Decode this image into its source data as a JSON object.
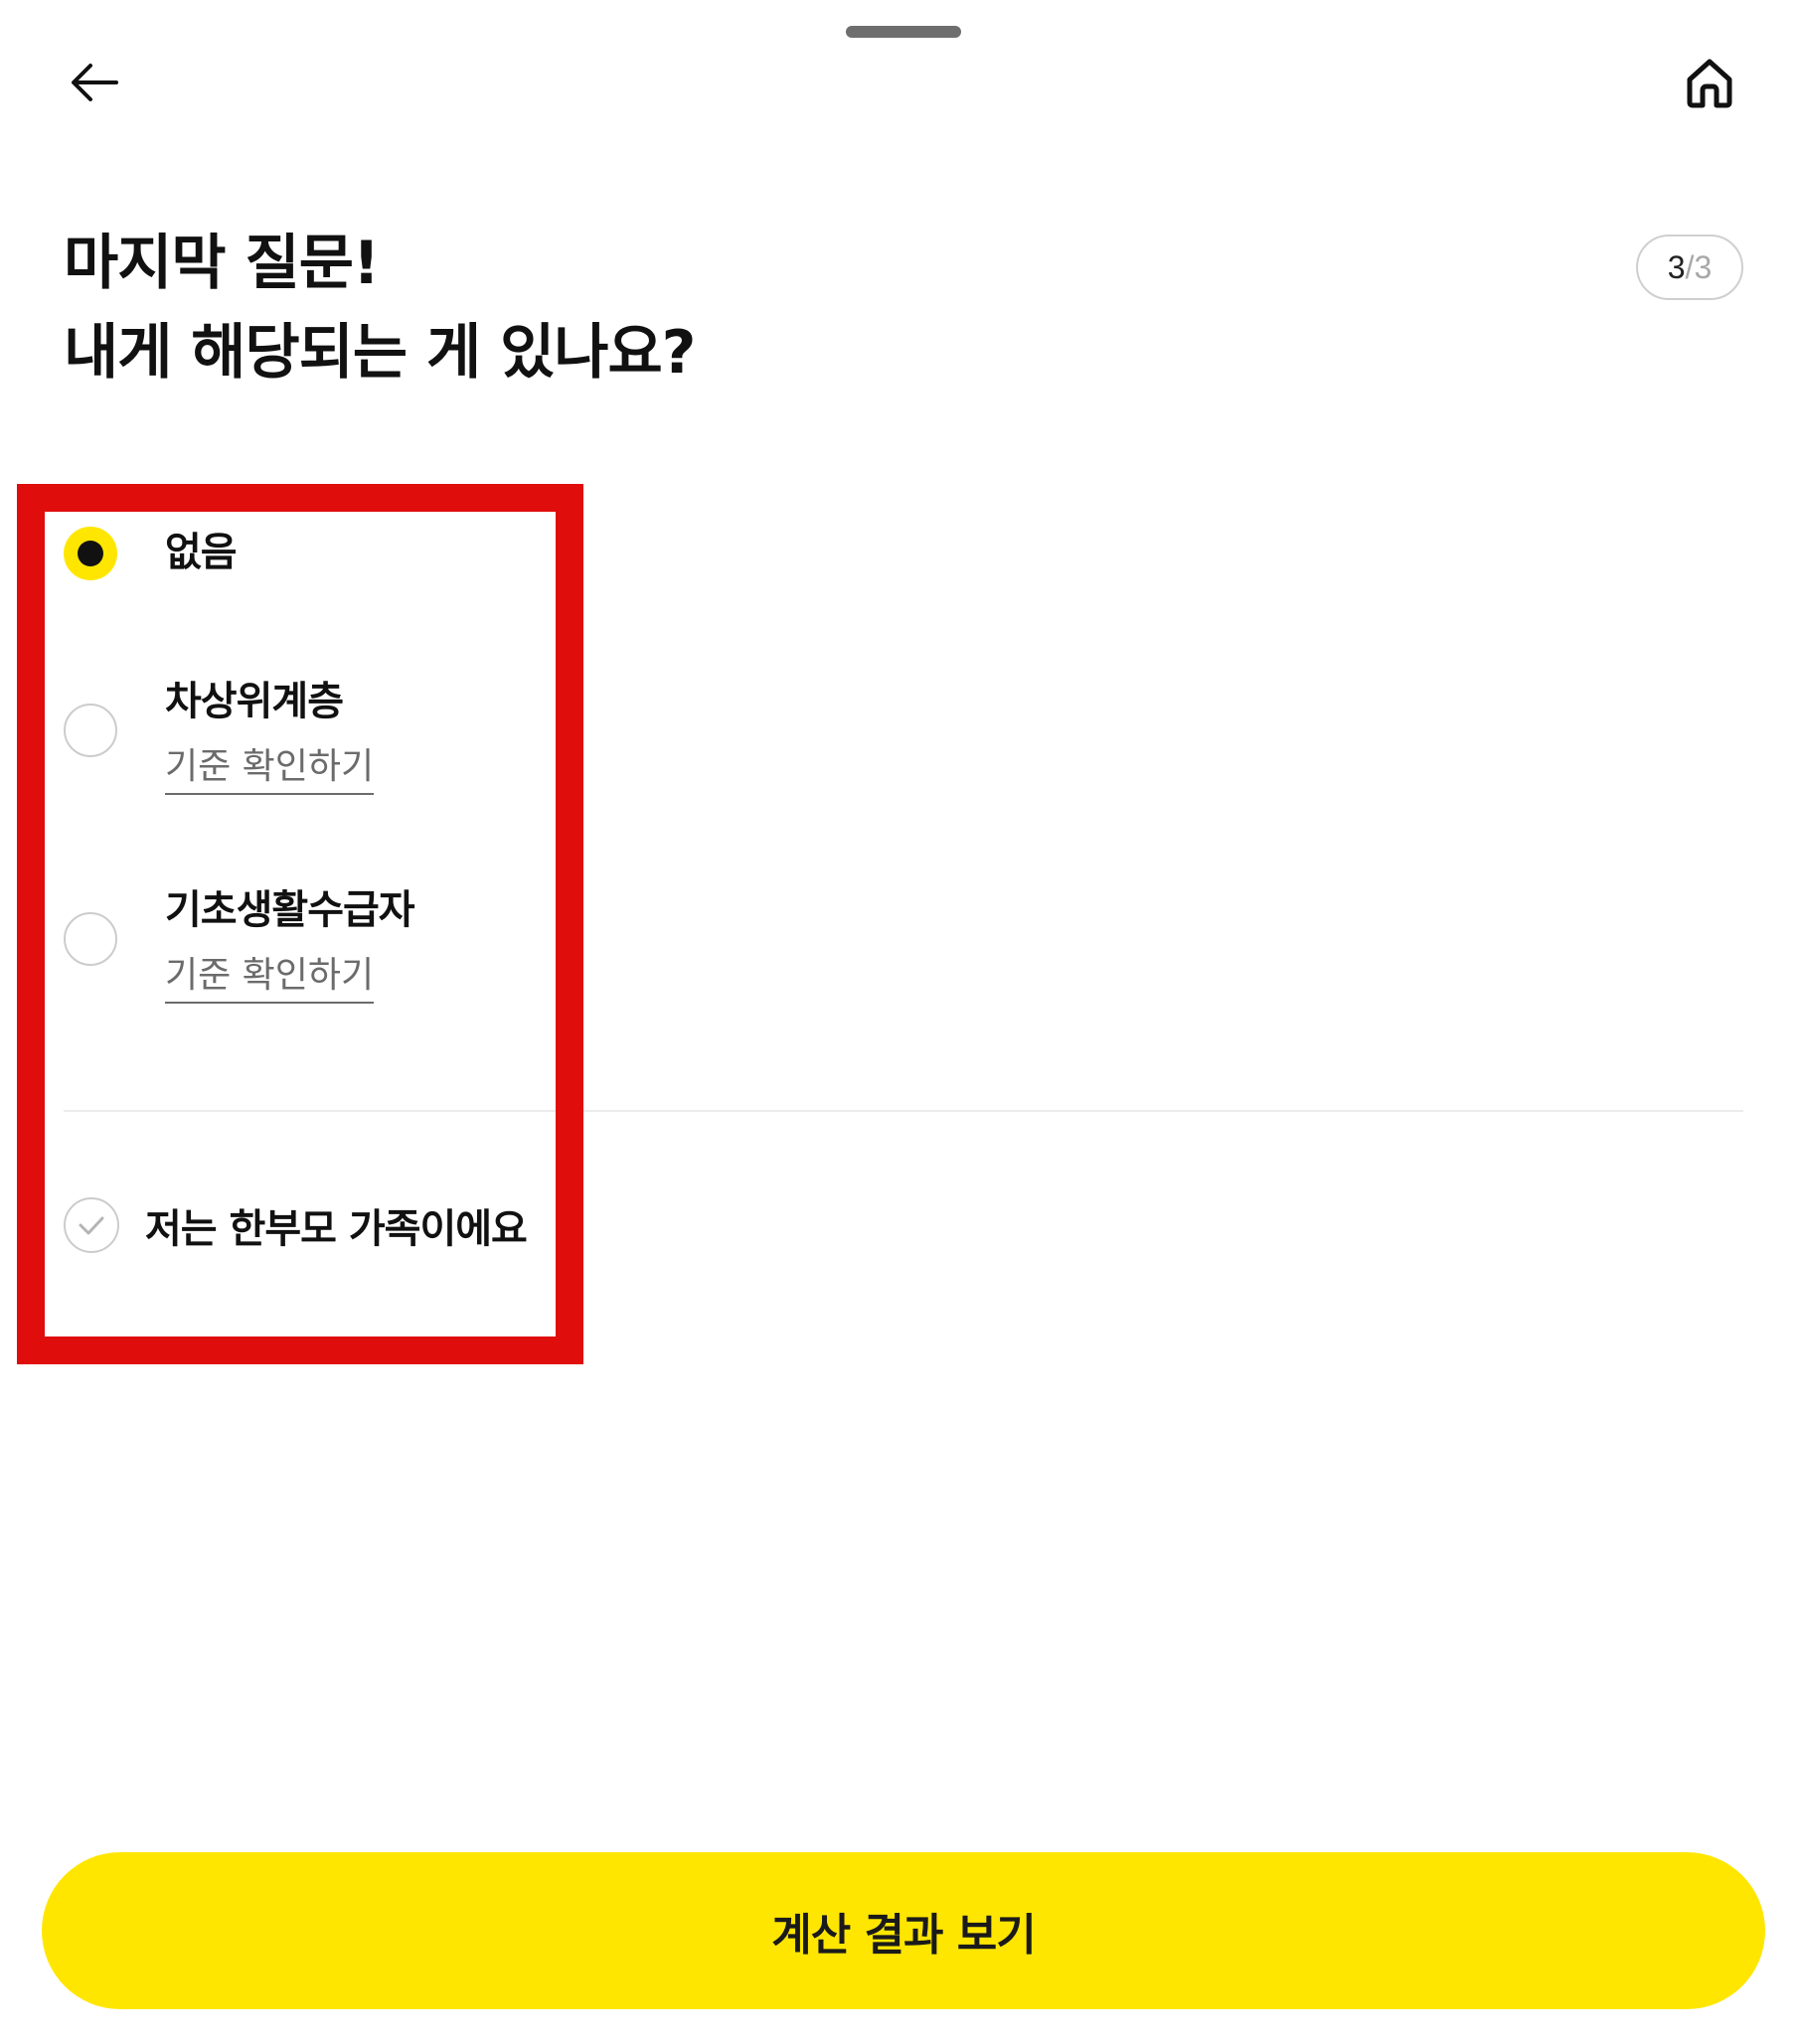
{
  "header": {
    "back_icon": "arrow-left-icon",
    "home_icon": "home-icon"
  },
  "title": {
    "line1": "마지막 질문!",
    "line2": "내게 해당되는 게 있나요?"
  },
  "step": {
    "current": "3",
    "separator": "/",
    "total": "3"
  },
  "options": [
    {
      "label": "없음",
      "selected": true
    },
    {
      "label": "차상위계층",
      "link": "기준 확인하기",
      "selected": false
    },
    {
      "label": "기초생활수급자",
      "link": "기준 확인하기",
      "selected": false
    }
  ],
  "checkbox": {
    "label": "저는 한부모 가족이에요",
    "checked": false
  },
  "cta": {
    "label": "계산 결과 보기"
  },
  "colors": {
    "accent": "#ffe600",
    "highlight": "#e00d0d",
    "text": "#111111",
    "muted": "#6b6b6b"
  }
}
